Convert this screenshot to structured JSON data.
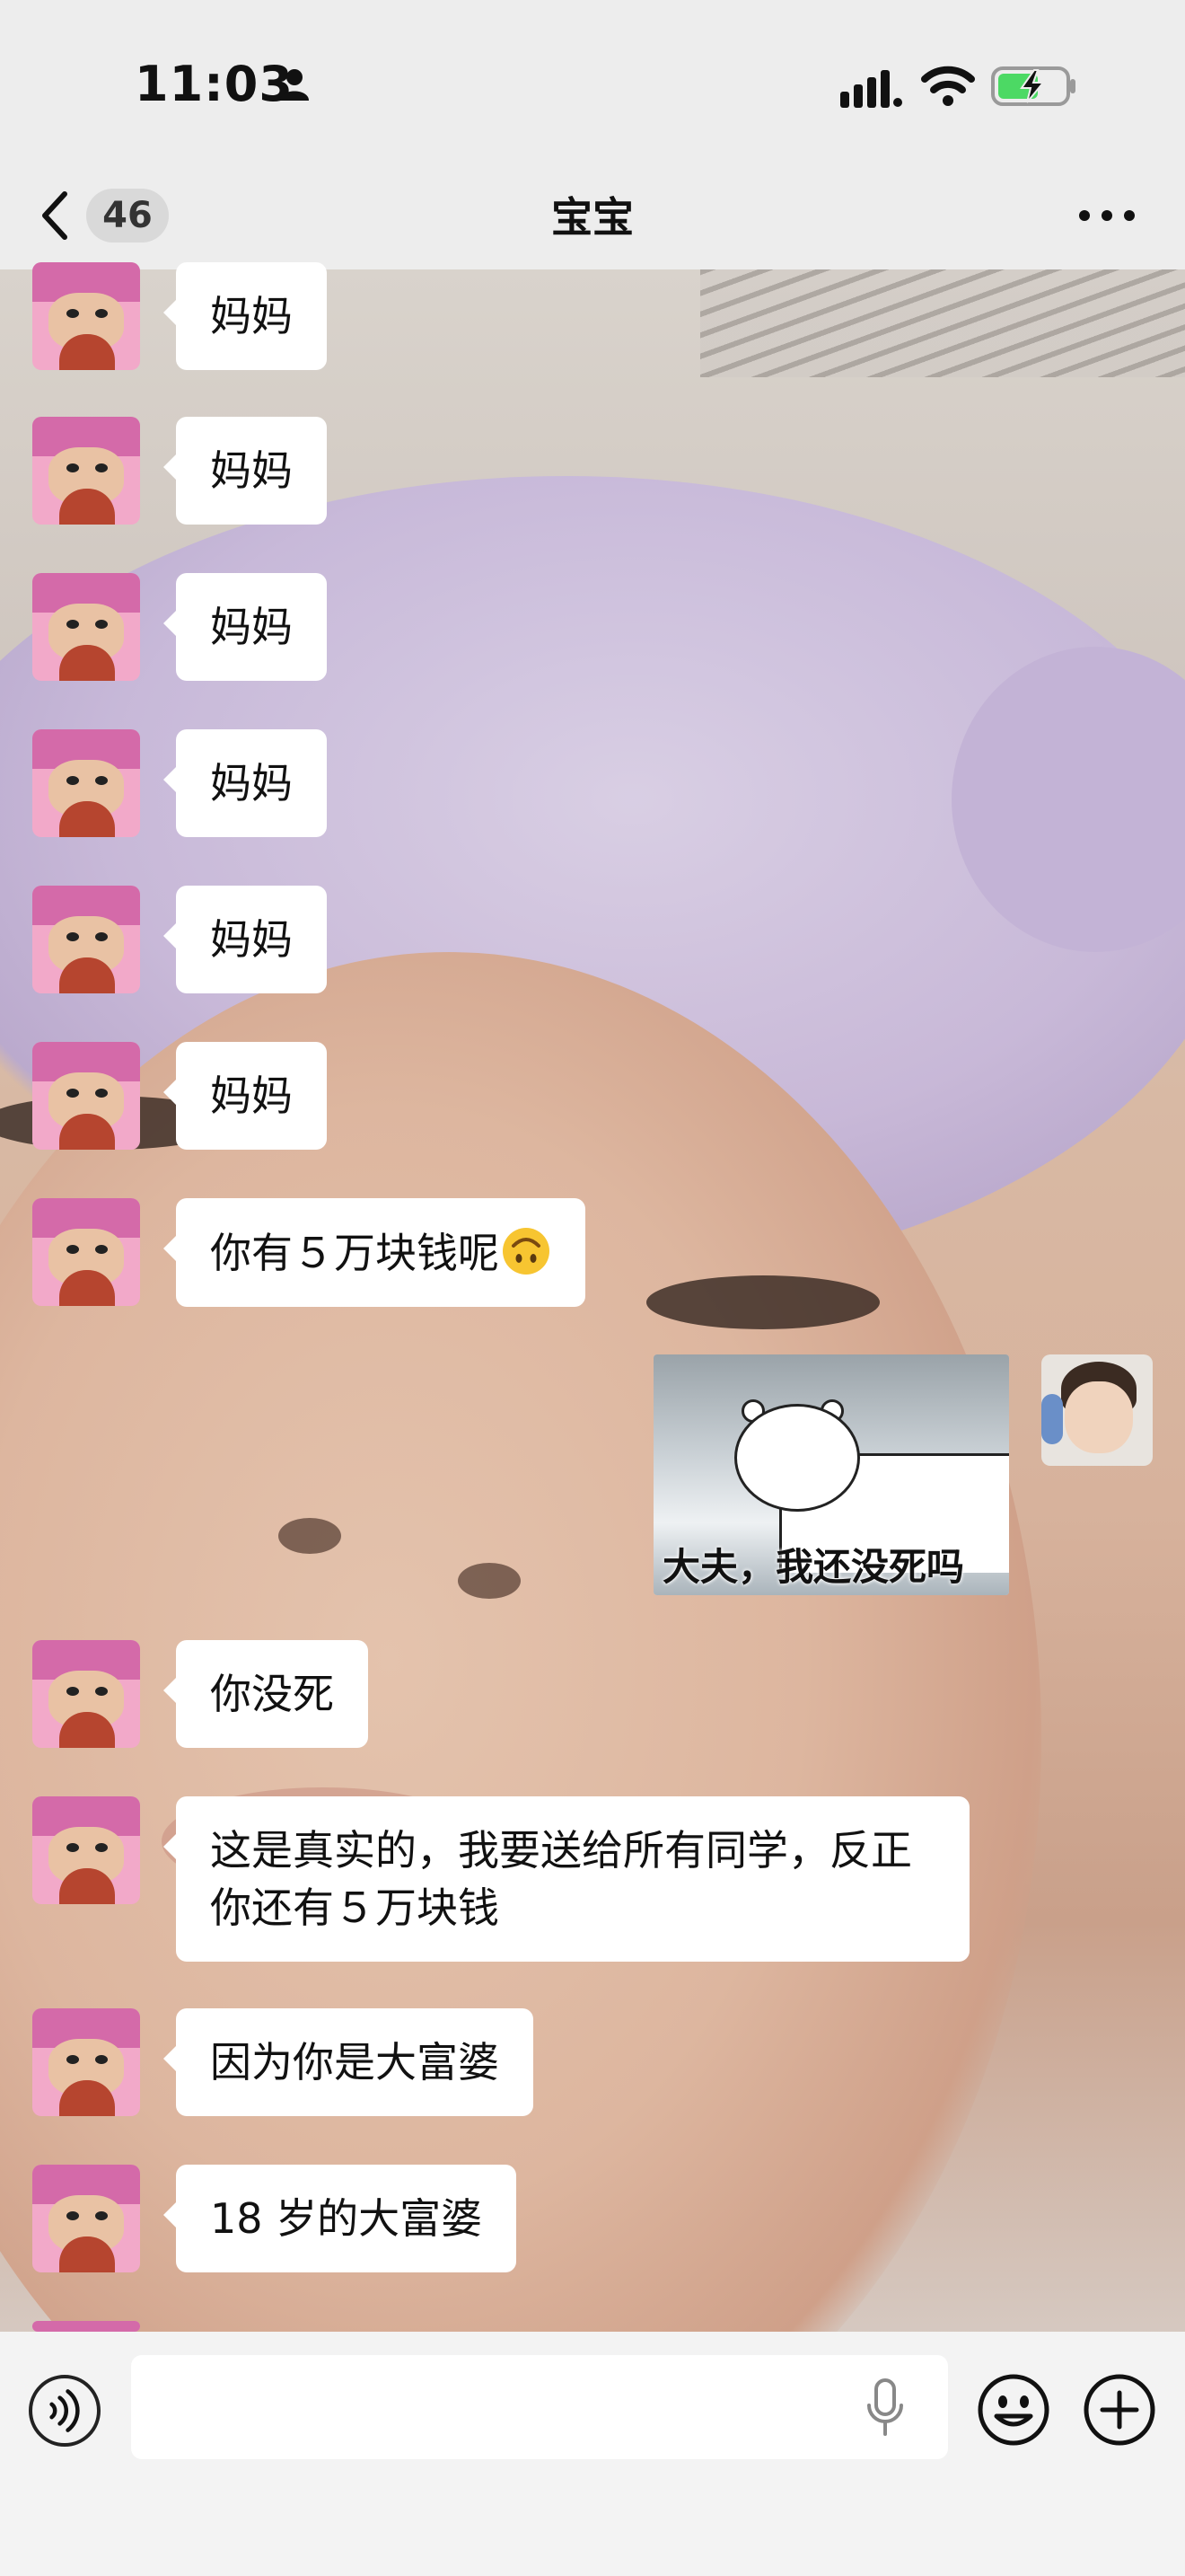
{
  "status_bar": {
    "time": "11:03"
  },
  "nav": {
    "back_count": "46",
    "title": "宝宝"
  },
  "messages": [
    {
      "side": "left",
      "text": "妈妈"
    },
    {
      "side": "left",
      "text": "妈妈"
    },
    {
      "side": "left",
      "text": "妈妈"
    },
    {
      "side": "left",
      "text": "妈妈"
    },
    {
      "side": "left",
      "text": "妈妈"
    },
    {
      "side": "left",
      "text": "妈妈"
    },
    {
      "side": "left",
      "text": "你有５万块钱呢",
      "emoji": "upside-down-face"
    },
    {
      "side": "right",
      "type": "sticker",
      "caption": "大夫，我还没死吗"
    },
    {
      "side": "left",
      "text": "你没死"
    },
    {
      "side": "left",
      "text": "这是真实的，我要送给所有同学，反正你还有５万块钱"
    },
    {
      "side": "left",
      "text": "因为你是大富婆"
    },
    {
      "side": "left",
      "text": "18 岁的大富婆"
    }
  ],
  "input": {
    "value": "",
    "placeholder": ""
  },
  "icons": {
    "back": "chevron-left-icon",
    "more": "more-icon",
    "voice": "voice-icon",
    "mic": "mic-icon",
    "emoji": "emoji-icon",
    "plus": "plus-icon"
  }
}
